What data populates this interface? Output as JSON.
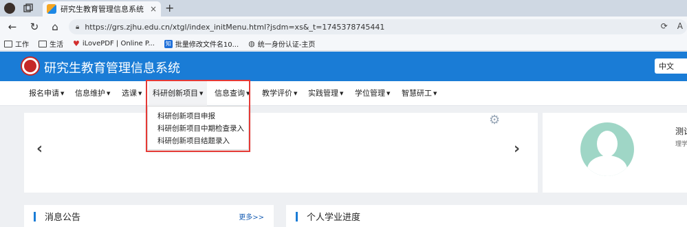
{
  "browser": {
    "tab_title": "研究生教育管理信息系统",
    "tab_close": "×",
    "new_tab": "+",
    "url": "https://grs.zjhu.edu.cn/xtgl/index_initMenu.html?jsdm=xs&_t=1745378745441",
    "icons": [
      "profile-avatar",
      "workspaces-icon",
      "tab-actions-icon",
      "back-icon",
      "refresh-icon",
      "home-icon",
      "lock-icon",
      "refresh-page-icon",
      "read-aloud-icon"
    ]
  },
  "bookmarks": [
    {
      "label": "工作",
      "icon": "folder-icon"
    },
    {
      "label": "生活",
      "icon": "folder-icon"
    },
    {
      "label": "iLovePDF | Online P...",
      "icon": "heart-icon"
    },
    {
      "label": "批量修改文件名10...",
      "icon": "zhi-icon"
    },
    {
      "label": "统一身份认证-主页",
      "icon": "globe-icon"
    }
  ],
  "app": {
    "title": "研究生教育管理信息系统",
    "language": "中文",
    "brand_color": "#1a7cd6"
  },
  "menu": [
    {
      "label": "报名申请"
    },
    {
      "label": "信息维护"
    },
    {
      "label": "选课"
    },
    {
      "label": "科研创新项目"
    },
    {
      "label": "信息查询"
    },
    {
      "label": "教学评价"
    },
    {
      "label": "实践管理"
    },
    {
      "label": "学位管理"
    },
    {
      "label": "智慧研工"
    }
  ],
  "dropdown": {
    "items": [
      "科研创新项目申报",
      "科研创新项目中期检查录入",
      "科研创新项目结题录入"
    ]
  },
  "profile": {
    "name": "测试",
    "dept": "理学"
  },
  "panels": {
    "notice_title": "消息公告",
    "more": "更多>>",
    "progress_title": "个人学业进度"
  },
  "highlight_color": "#e53935"
}
